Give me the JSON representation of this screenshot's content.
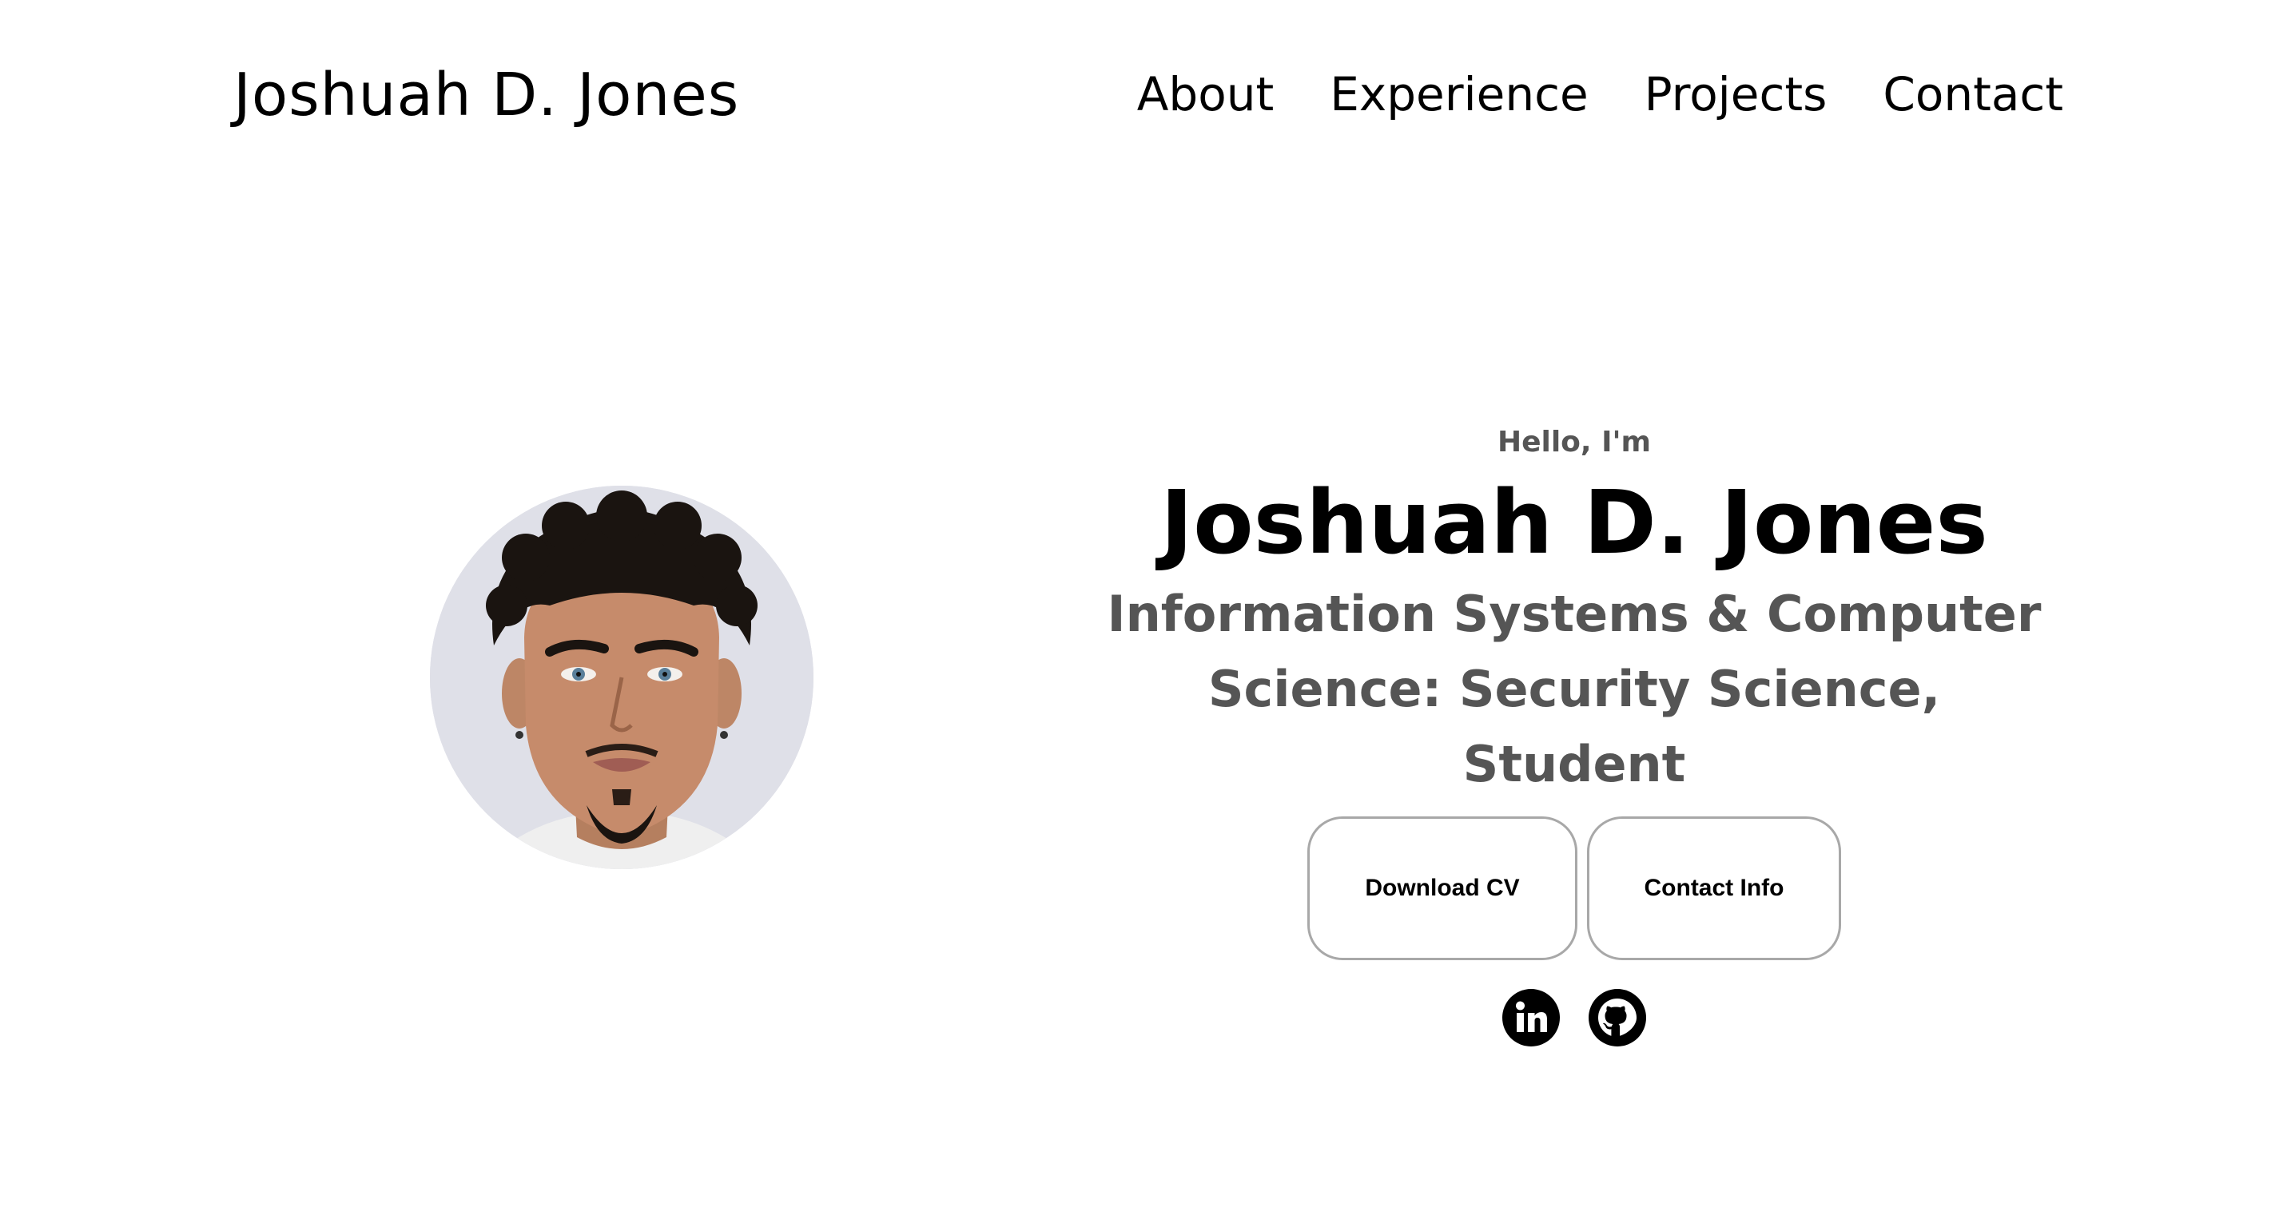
{
  "header": {
    "logo_text": "Joshuah D. Jones",
    "nav": [
      {
        "label": "About"
      },
      {
        "label": "Experience"
      },
      {
        "label": "Projects"
      },
      {
        "label": "Contact"
      }
    ]
  },
  "hero": {
    "greeting": "Hello, I'm",
    "name": "Joshuah D. Jones",
    "subtitle": "Information Systems & Computer Science: Security Science, Student",
    "buttons": {
      "download_cv": "Download CV",
      "contact_info": "Contact Info"
    },
    "socials": [
      {
        "icon": "linkedin-icon"
      },
      {
        "icon": "github-icon"
      }
    ]
  },
  "colors": {
    "text": "#000000",
    "muted_text": "#555555",
    "button_border": "#a8a8a8",
    "photo_background": "#dfe0e8"
  }
}
